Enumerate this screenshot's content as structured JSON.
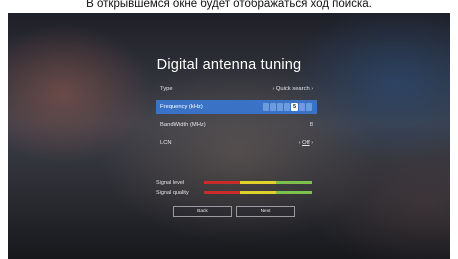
{
  "caption": "В открывшемся окне будет отображаться ход поиска.",
  "dialog": {
    "title": "Digital antenna tuning",
    "rows": {
      "type": {
        "label": "Type",
        "value": "Quick search",
        "left_arrow": "‹",
        "right_arrow": "›"
      },
      "frequency": {
        "label": "Frequency (kHz)",
        "digits": [
          "",
          "",
          "",
          "",
          "5",
          "",
          ""
        ],
        "active_digit_index": 4
      },
      "bandwidth": {
        "label": "BandWidth (MHz)",
        "value": "8"
      },
      "lcn": {
        "label": "LCN",
        "value": "Off",
        "left_arrow": "‹",
        "right_arrow": "›"
      }
    },
    "signal_level": {
      "label": "Signal level"
    },
    "signal_quality": {
      "label": "Signal quality"
    },
    "buttons": {
      "back": "Back",
      "next": "Next"
    }
  },
  "colors": {
    "selected_row": "#3a73c6",
    "bar_red": "#cc2b2b",
    "bar_yellow": "#e0d22a",
    "bar_green": "#7cc24a"
  }
}
